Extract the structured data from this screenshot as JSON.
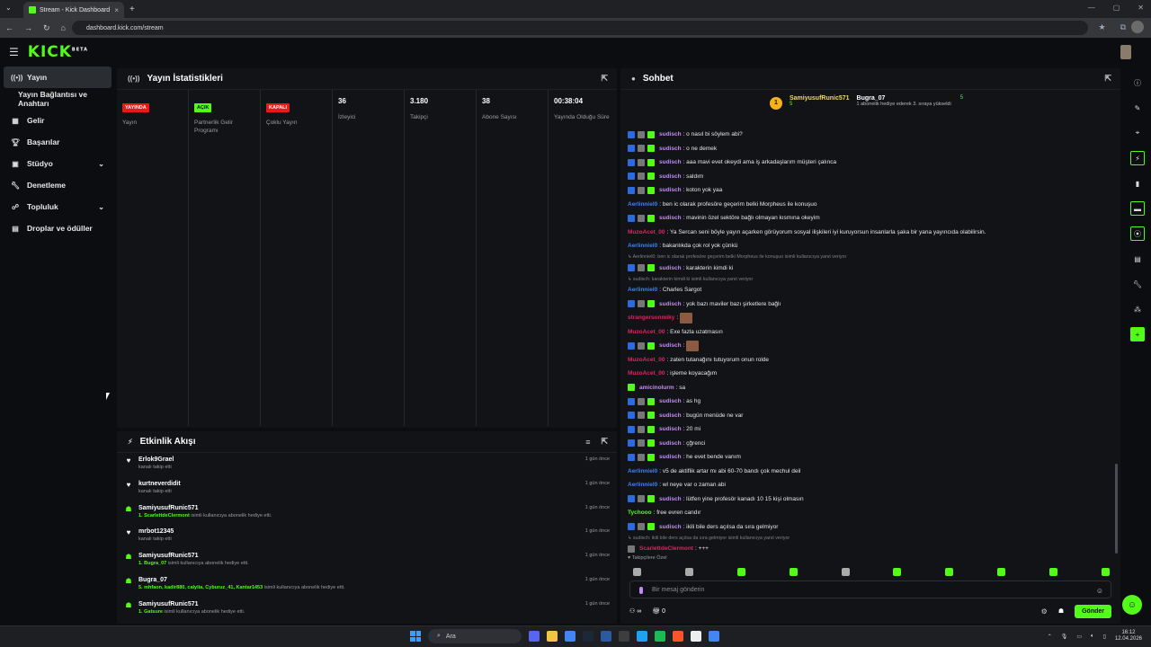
{
  "browser": {
    "tab_title": "Stream - Kick Dashboard",
    "url": "dashboard.kick.com/stream"
  },
  "header": {
    "logo": "KICK",
    "logo_mark": "BETA"
  },
  "nav": {
    "items": [
      {
        "label": "Yayın",
        "icon": "broadcast-icon"
      },
      {
        "label": "Yayın Bağlantısı ve Anahtarı",
        "icon": ""
      },
      {
        "label": "Gelir",
        "icon": "money-icon"
      },
      {
        "label": "Başarılar",
        "icon": "trophy-icon"
      },
      {
        "label": "Stüdyo",
        "icon": "studio-icon"
      },
      {
        "label": "Denetleme",
        "icon": "wrench-icon"
      },
      {
        "label": "Topluluk",
        "icon": "community-icon"
      },
      {
        "label": "Droplar ve ödüller",
        "icon": "drops-icon"
      }
    ]
  },
  "stats": {
    "title": "Yayın İstatistikleri",
    "columns": [
      {
        "badge": "YAYINDA",
        "label": "Yayın"
      },
      {
        "badge": "AÇIK",
        "label": "Partnerlik Gelir Programı"
      },
      {
        "badge": "KAPALI",
        "label": "Çoklu Yayın"
      },
      {
        "value": "36",
        "label": "İzleyici"
      },
      {
        "value": "3.180",
        "label": "Takipçi"
      },
      {
        "value": "38",
        "label": "Abone Sayısı"
      },
      {
        "value": "00:38:04",
        "label": "Yayında Olduğu Süre"
      }
    ]
  },
  "activity": {
    "title": "Etkinlik Akışı",
    "items": [
      {
        "type": "follow",
        "name": "Erlok9Grael",
        "desc_pre": "",
        "desc_hl": "",
        "desc": "kanalı takip etti",
        "time": "1 gün önce"
      },
      {
        "type": "follow",
        "name": "kurtneverdidit",
        "desc_pre": "",
        "desc_hl": "",
        "desc": "kanalı takip etti",
        "time": "1 gün önce"
      },
      {
        "type": "gift",
        "name": "SamiyusufRunic571",
        "desc_pre": "",
        "desc_hl": "1. ScarlettdeClermont",
        "desc": " isimli kullanıcıya abonelik hediye etti.",
        "time": "1 gün önce"
      },
      {
        "type": "follow",
        "name": "mrbot12345",
        "desc_pre": "",
        "desc_hl": "",
        "desc": "kanalı takip etti",
        "time": "1 gün önce"
      },
      {
        "type": "gift",
        "name": "SamiyusufRunic571",
        "desc_pre": "",
        "desc_hl": "1. Bugra_07",
        "desc": " isimli kullanıcıya abonelik hediye etti.",
        "time": "1 gün önce"
      },
      {
        "type": "gift",
        "name": "Bugra_07",
        "desc_pre": "",
        "desc_hl": "5. mhfaon, kadir880, calylia, Cyburuz_41, Kantar1453",
        "desc": " isimli kullanıcıya abonelik hediye etti.",
        "time": "1 gün önce"
      },
      {
        "type": "gift",
        "name": "SamiyusufRunic571",
        "desc_pre": "",
        "desc_hl": "1. Gatsure",
        "desc": " isimli kullanıcıya abonelik hediye etti.",
        "time": "1 gün önce"
      }
    ]
  },
  "chat": {
    "title": "Sohbet",
    "pinned": {
      "rank": "1",
      "user1": "SamiyusufRunic571",
      "user1_count": "5",
      "user2": "Bugra_07",
      "user2_count": "5",
      "user2_desc": "1 abonelik hediye ederek 3. sıraya yükseldi"
    },
    "messages": [
      {
        "kind": "msg",
        "badges": [
          "blue",
          "grey",
          "green"
        ],
        "user": "sudisch",
        "color": "purple",
        "text": ": o nasıl bi söylem abi?"
      },
      {
        "kind": "msg",
        "badges": [
          "blue",
          "grey",
          "green"
        ],
        "user": "sudisch",
        "color": "purple",
        "text": ": o ne demek"
      },
      {
        "kind": "msg",
        "badges": [
          "blue",
          "grey",
          "green"
        ],
        "user": "sudisch",
        "color": "purple",
        "text": ": aaa mavi evet okeydi ama iş arkadaşlarım müşteri çalınca"
      },
      {
        "kind": "msg",
        "badges": [
          "blue",
          "grey",
          "green"
        ],
        "user": "sudisch",
        "color": "purple",
        "text": ": saldım"
      },
      {
        "kind": "msg",
        "badges": [
          "blue",
          "grey",
          "green"
        ],
        "user": "sudisch",
        "color": "purple",
        "text": ": koton yok yaa"
      },
      {
        "kind": "msg",
        "badges": [],
        "user": "Aerlinniel0",
        "color": "blue",
        "text": ": ben ic olarak profesöre geçerim belki Morpheus ile konuşuo"
      },
      {
        "kind": "msg",
        "badges": [
          "blue",
          "grey",
          "green"
        ],
        "user": "sudisch",
        "color": "purple",
        "text": ": mavinin özel sektöre bağlı olmayan kısmına okeyim"
      },
      {
        "kind": "msg",
        "badges": [],
        "user": "MuzoAcet_00",
        "color": "red",
        "text": ": Ya Sercan seni böyle yayın açarken görüyorum sosyal ilişkileri iyi kuruyorsun insanlarla şaka bir yana yayıncıda olabilirsin."
      },
      {
        "kind": "msg",
        "badges": [],
        "user": "Aerlinniel0",
        "color": "blue",
        "text": ": bakanlıkda çok rol yok çünkü"
      },
      {
        "kind": "reply",
        "text": "↳ Aerlinniel0: ben ic olarak profesöre geçerim belki Morpheus ile konuşuo isimli kullanıcıya yanıt veriyor"
      },
      {
        "kind": "msg",
        "badges": [
          "blue",
          "grey",
          "green"
        ],
        "user": "sudisch",
        "color": "purple",
        "text": ": karakterin kimdi ki"
      },
      {
        "kind": "reply",
        "text": "↳ sudisch: karakterin kimdi ki isimli kullanıcıya yanıt veriyor"
      },
      {
        "kind": "msg",
        "badges": [],
        "user": "Aerlinniel0",
        "color": "blue",
        "text": ": Charles Sargot"
      },
      {
        "kind": "msg",
        "badges": [
          "blue",
          "grey",
          "green"
        ],
        "user": "sudisch",
        "color": "purple",
        "text": ": yok bazı maviler bazı şirketlere bağlı"
      },
      {
        "kind": "emote",
        "badges": [],
        "user": "strangersonmiky",
        "color": "red",
        "text": ":"
      },
      {
        "kind": "msg",
        "badges": [],
        "user": "MuzoAcet_00",
        "color": "red",
        "text": ": Exe fazla uzatmasın"
      },
      {
        "kind": "emote",
        "badges": [
          "blue",
          "grey",
          "green"
        ],
        "user": "sudisch",
        "color": "purple",
        "text": ":"
      },
      {
        "kind": "msg",
        "badges": [],
        "user": "MuzoAcet_00",
        "color": "red",
        "text": ": zaten tutanağını tutuyorum onun rolde"
      },
      {
        "kind": "msg",
        "badges": [],
        "user": "MuzoAcet_00",
        "color": "red",
        "text": ": işleme koyacağım"
      },
      {
        "kind": "msg",
        "badges": [
          "green"
        ],
        "user": "amicinolurm",
        "color": "purple",
        "text": ": sa"
      },
      {
        "kind": "msg",
        "badges": [
          "blue",
          "grey",
          "green"
        ],
        "user": "sudisch",
        "color": "purple",
        "text": ": as hg"
      },
      {
        "kind": "msg",
        "badges": [
          "blue",
          "grey",
          "green"
        ],
        "user": "sudisch",
        "color": "purple",
        "text": ": bugün menüde ne var"
      },
      {
        "kind": "msg",
        "badges": [
          "blue",
          "grey",
          "green"
        ],
        "user": "sudisch",
        "color": "purple",
        "text": ": 20 mi"
      },
      {
        "kind": "msg",
        "badges": [
          "blue",
          "grey",
          "green"
        ],
        "user": "sudisch",
        "color": "purple",
        "text": ": çğrenci"
      },
      {
        "kind": "msg",
        "badges": [
          "blue",
          "grey",
          "green"
        ],
        "user": "sudisch",
        "color": "purple",
        "text": ": he evet bende vanım"
      },
      {
        "kind": "msg",
        "badges": [],
        "user": "Aerlinniel0",
        "color": "blue",
        "text": ": v5 de aktiflik artar mı abi 60-70 bandı çok mechul deil"
      },
      {
        "kind": "msg",
        "badges": [],
        "user": "Aerlinniel0",
        "color": "blue",
        "text": ": wl neye var o zaman abi"
      },
      {
        "kind": "msg",
        "badges": [
          "blue",
          "grey",
          "green"
        ],
        "user": "sudisch",
        "color": "purple",
        "text": ": lütfen yine profesör kanadı 10 15 kişi olmasın"
      },
      {
        "kind": "msg",
        "badges": [],
        "user": "Tychooo",
        "color": "green",
        "text": ": free evren candır"
      },
      {
        "kind": "msg",
        "badges": [
          "blue",
          "grey",
          "green"
        ],
        "user": "sudisch",
        "color": "purple",
        "text": ": ikili bile ders açılsa da sıra gelmiyor"
      },
      {
        "kind": "reply",
        "text": "↳ sudisch: ikili bile ders açılsa da sıra gelmiyor isimli kullanıcıya yanıt veriyor"
      },
      {
        "kind": "msg",
        "badges": [
          "grey"
        ],
        "user": "ScarlettdeClermont",
        "color": "red",
        "text": ": +++"
      }
    ],
    "followers_only": "♥ Takipçilere Özel",
    "input_placeholder": "Bir mesaj gönderin",
    "footer_count": "0",
    "send_label": "Gönder"
  },
  "taskbar": {
    "search_placeholder": "Ara",
    "time": "16:12",
    "date": "12.04.2026"
  }
}
